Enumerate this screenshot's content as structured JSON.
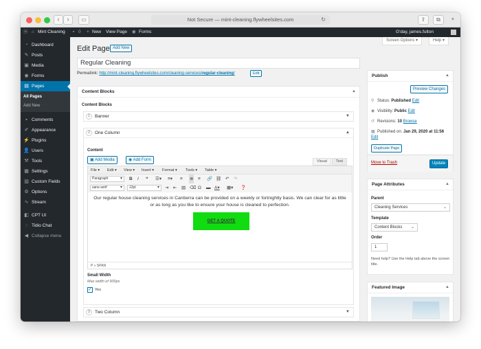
{
  "browser": {
    "url": "Not Secure — mint-cleaning.flywheelsites.com",
    "reload_icon": "reload-icon",
    "back_icon": "chevron-left-icon",
    "forward_icon": "chevron-right-icon",
    "sidebar_toggle_icon": "sidebar-icon",
    "share_icon": "share-icon",
    "tabs_icon": "tabs-icon",
    "add_tab_icon": "plus-icon"
  },
  "adminbar": {
    "wp_icon": "wordpress-icon",
    "site_name": "Mint Cleaning",
    "comments_count": "0",
    "new_label": "New",
    "view_page": "View Page",
    "forms": "Forms",
    "greeting": "G'day, james.fulton"
  },
  "sidebar": {
    "items": [
      {
        "label": "Dashboard",
        "icon": "dashboard-icon"
      },
      {
        "label": "Posts",
        "icon": "pin-icon"
      },
      {
        "label": "Media",
        "icon": "media-icon"
      },
      {
        "label": "Forms",
        "icon": "forms-icon"
      },
      {
        "label": "Pages",
        "icon": "pages-icon"
      },
      {
        "label": "Comments",
        "icon": "comments-icon"
      },
      {
        "label": "Appearance",
        "icon": "appearance-icon"
      },
      {
        "label": "Plugins",
        "icon": "plugins-icon"
      },
      {
        "label": "Users",
        "icon": "users-icon"
      },
      {
        "label": "Tools",
        "icon": "tools-icon"
      },
      {
        "label": "Settings",
        "icon": "settings-icon"
      },
      {
        "label": "Custom Fields",
        "icon": "custom-fields-icon"
      },
      {
        "label": "Options",
        "icon": "options-icon"
      },
      {
        "label": "Stream",
        "icon": "stream-icon"
      },
      {
        "label": "CPT UI",
        "icon": "cpt-ui-icon"
      },
      {
        "label": "Tidio Chat",
        "icon": "chat-icon"
      },
      {
        "label": "Collapse menu",
        "icon": "collapse-icon"
      }
    ],
    "submenu": [
      "All Pages",
      "Add New"
    ]
  },
  "header": {
    "screen_options": "Screen Options ▾",
    "help": "Help ▾",
    "title": "Edit Page",
    "add_new": "Add New"
  },
  "post": {
    "title": "Regular Cleaning",
    "permalink_label": "Permalink:",
    "permalink_base": "http://mint-cleaning.flywheelsites.com/cleaning-services/",
    "permalink_slug": "regular-cleaning",
    "permalink_tail": "/",
    "edit_label": "Edit"
  },
  "content_blocks": {
    "box_title": "Content Blocks",
    "section_label": "Content Blocks",
    "layouts": [
      {
        "num": "1",
        "name": "Banner"
      },
      {
        "num": "2",
        "name": "One Column"
      },
      {
        "num": "3",
        "name": "Two Column"
      }
    ],
    "content_label": "Content",
    "add_media": "Add Media",
    "add_form": "Add Form",
    "visual_tab": "Visual",
    "text_tab": "Text",
    "menubar": [
      "File ▾",
      "Edit ▾",
      "View ▾",
      "Insert ▾",
      "Format ▾",
      "Tools ▾",
      "Table ▾"
    ],
    "paragraph_select": "Paragraph",
    "font_select": "sans-serif",
    "size_select": "12pt",
    "body_text": "Our regular house cleaning services in Canberra can be provided on a weekly or fortnightly basis. We can clear for as little or as long as you like to ensure your house is cleaned to perfection.",
    "cta": "GET A QUOTE",
    "cta_color": "#11dc11",
    "statusbar": "P » SPAN",
    "small_width_label": "Small Width",
    "small_width_hint": "Max width of 900px",
    "small_width_value": "Yes"
  },
  "publish": {
    "title": "Publish",
    "preview": "Preview Changes",
    "status_label": "Status:",
    "status_value": "Published",
    "visibility_label": "Visibility:",
    "visibility_value": "Public",
    "revisions_label": "Revisions:",
    "revisions_value": "10",
    "browse": "Browse",
    "published_label": "Published on:",
    "published_value": "Jan 29, 2020 at 11:56",
    "edit": "Edit",
    "duplicate": "Duplicate Page",
    "trash": "Move to Trash",
    "update": "Update"
  },
  "attributes": {
    "title": "Page Attributes",
    "parent_label": "Parent",
    "parent_value": "Cleaning Services",
    "template_label": "Template",
    "template_value": "Content Blocks",
    "order_label": "Order",
    "order_value": "1",
    "help_text": "Need help? Use the Help tab above the screen title."
  },
  "featured": {
    "title": "Featured Image"
  },
  "colors": {
    "admin_dark": "#23282d",
    "accent_blue": "#0073aa",
    "primary_button": "#0085ba",
    "trash_red": "#a00"
  }
}
